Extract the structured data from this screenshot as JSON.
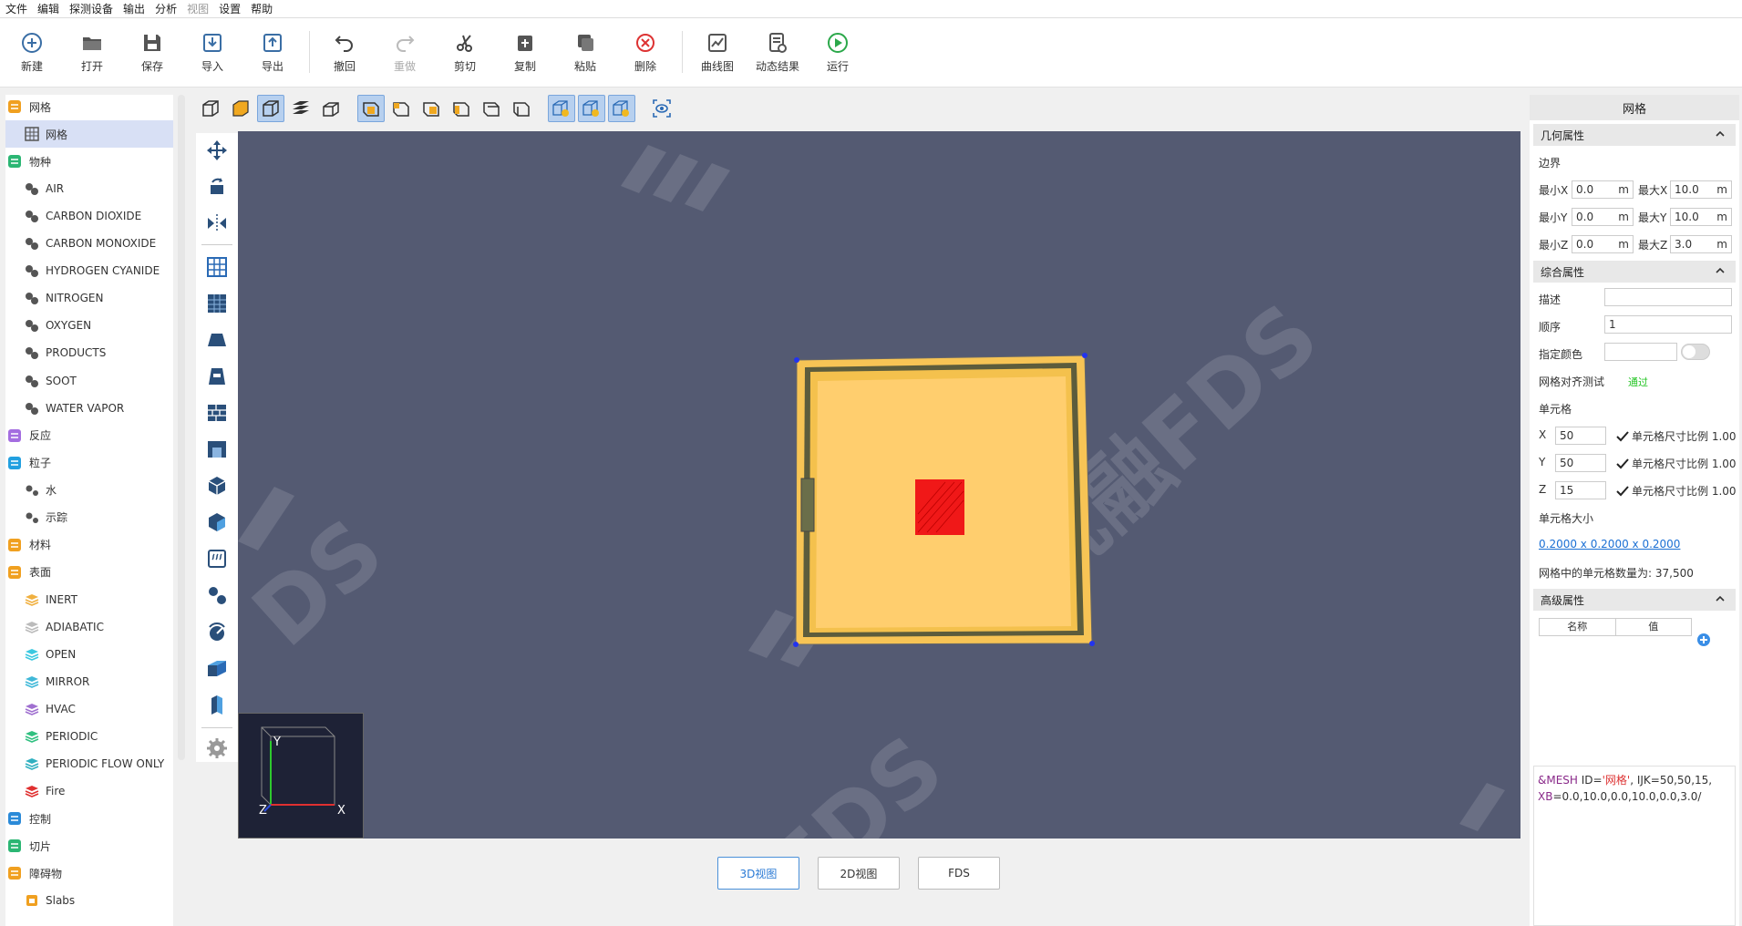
{
  "menu": [
    "文件",
    "编辑",
    "探测设备",
    "输出",
    "分析",
    "视图",
    "设置",
    "帮助"
  ],
  "menu_disabled_index": 5,
  "toolbar": [
    {
      "label": "新建",
      "icon": "new-plus-icon"
    },
    {
      "label": "打开",
      "icon": "folder-open-icon"
    },
    {
      "label": "保存",
      "icon": "save-disk-icon"
    },
    {
      "label": "导入",
      "icon": "import-icon"
    },
    {
      "label": "导出",
      "icon": "export-icon"
    },
    {
      "label": "撤回",
      "icon": "undo-icon"
    },
    {
      "label": "重做",
      "icon": "redo-icon",
      "disabled": true
    },
    {
      "label": "剪切",
      "icon": "scissors-icon"
    },
    {
      "label": "复制",
      "icon": "copy-icon"
    },
    {
      "label": "粘贴",
      "icon": "paste-icon"
    },
    {
      "label": "删除",
      "icon": "delete-x-icon"
    },
    {
      "label": "曲线图",
      "icon": "line-chart-icon"
    },
    {
      "label": "动态结果",
      "icon": "dynamic-result-icon"
    },
    {
      "label": "运行",
      "icon": "run-play-icon"
    }
  ],
  "tree": {
    "rows": [
      {
        "label": "网格",
        "level": 0,
        "icon_color": "#f0a020"
      },
      {
        "label": "网格",
        "level": 1,
        "selected": true,
        "icon": "grid-icon"
      },
      {
        "label": "物种",
        "level": 0,
        "icon_color": "#2bb673"
      },
      {
        "label": "AIR",
        "level": 1,
        "icon": "species-icon"
      },
      {
        "label": "CARBON DIOXIDE",
        "level": 1,
        "icon": "species-icon"
      },
      {
        "label": "CARBON MONOXIDE",
        "level": 1,
        "icon": "species-icon"
      },
      {
        "label": "HYDROGEN CYANIDE",
        "level": 1,
        "icon": "species-icon"
      },
      {
        "label": "NITROGEN",
        "level": 1,
        "icon": "species-icon"
      },
      {
        "label": "OXYGEN",
        "level": 1,
        "icon": "species-icon"
      },
      {
        "label": "PRODUCTS",
        "level": 1,
        "icon": "species-icon"
      },
      {
        "label": "SOOT",
        "level": 1,
        "icon": "species-icon"
      },
      {
        "label": "WATER VAPOR",
        "level": 1,
        "icon": "species-icon"
      },
      {
        "label": "反应",
        "level": 0,
        "icon_color": "#a46de0"
      },
      {
        "label": "粒子",
        "level": 0,
        "icon_color": "#22a0e0"
      },
      {
        "label": "水",
        "level": 1,
        "icon": "particle-icon"
      },
      {
        "label": "示踪",
        "level": 1,
        "icon": "particle-icon"
      },
      {
        "label": "材料",
        "level": 0,
        "icon_color": "#f0a020"
      },
      {
        "label": "表面",
        "level": 0,
        "icon_color": "#f0a020"
      },
      {
        "label": "INERT",
        "level": 1,
        "icon": "surface-icon",
        "color": "#f0b040"
      },
      {
        "label": "ADIABATIC",
        "level": 1,
        "icon": "surface-icon",
        "color": "#bbbbbb"
      },
      {
        "label": "OPEN",
        "level": 1,
        "icon": "surface-icon",
        "color": "#3cc8e0"
      },
      {
        "label": "MIRROR",
        "level": 1,
        "icon": "surface-icon",
        "color": "#40b8d8"
      },
      {
        "label": "HVAC",
        "level": 1,
        "icon": "surface-icon",
        "color": "#a070d0"
      },
      {
        "label": "PERIODIC",
        "level": 1,
        "icon": "surface-icon",
        "color": "#30c080"
      },
      {
        "label": "PERIODIC FLOW ONLY",
        "level": 1,
        "icon": "surface-icon",
        "color": "#30b0c0"
      },
      {
        "label": "Fire",
        "level": 1,
        "icon": "surface-icon",
        "color": "#e03030"
      },
      {
        "label": "控制",
        "level": 0,
        "icon_color": "#2a8ad8"
      },
      {
        "label": "切片",
        "level": 0,
        "icon_color": "#2bb673"
      },
      {
        "label": "障碍物",
        "level": 0,
        "icon_color": "#f0a020"
      },
      {
        "label": "Slabs",
        "level": 1,
        "icon": "obstruction-icon"
      }
    ]
  },
  "bottom_tabs": [
    {
      "label": "3D视图",
      "active": true
    },
    {
      "label": "2D视图",
      "active": false
    },
    {
      "label": "FDS",
      "active": false
    }
  ],
  "viewport": {
    "axis_labels": {
      "x": "X",
      "y": "Y",
      "z": "Z"
    },
    "watermark": "祝融FDS"
  },
  "props": {
    "title": "网格",
    "geometry": {
      "header": "几何属性",
      "boundary_label": "边界",
      "min_x_label": "最小X",
      "min_x": "0.0",
      "max_x_label": "最大X",
      "max_x": "10.0",
      "min_y_label": "最小Y",
      "min_y": "0.0",
      "max_y_label": "最大Y",
      "max_y": "10.0",
      "min_z_label": "最小Z",
      "min_z": "0.0",
      "max_z_label": "最大Z",
      "max_z": "3.0",
      "unit": "m"
    },
    "general": {
      "header": "综合属性",
      "desc_label": "描述",
      "desc": "",
      "order_label": "顺序",
      "order": "1",
      "color_label": "指定颜色",
      "align_label": "网格对齐测试",
      "align_status": "通过",
      "cells_label": "单元格",
      "x_label": "X",
      "x": "50",
      "y_label": "Y",
      "y": "50",
      "z_label": "Z",
      "z": "15",
      "ratio_text": "单元格尺寸比例 1.00",
      "size_label": "单元格大小",
      "size_value": "0.2000 x 0.2000 x 0.2000",
      "count_text": "网格中的单元格数量为: 37,500"
    },
    "advanced": {
      "header": "高级属性",
      "col_name": "名称",
      "col_value": "值"
    },
    "code": {
      "p1": "&MESH",
      "p2": " ID=",
      "p3": "'网格'",
      "p4": ", IJK=50,50,15,",
      "p5": "XB",
      "p6": "=0.0,10.0,0.0,10.0,0.0,3.0/"
    }
  }
}
